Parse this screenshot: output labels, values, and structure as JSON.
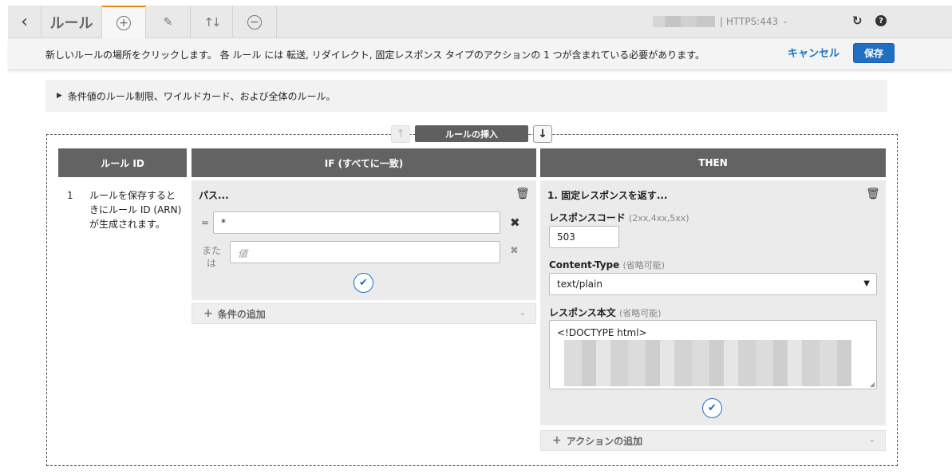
{
  "toolbar": {
    "back_icon": "chevron-left-icon",
    "title": "ルール",
    "add_icon": "plus-circle-icon",
    "edit_icon": "pencil-icon",
    "reorder_icon": "sort-arrows-icon",
    "remove_icon": "minus-circle-icon",
    "listener": "| HTTPS:443",
    "refresh_icon": "refresh-icon",
    "help_icon": "help-icon",
    "accent_color": "#e68a1a"
  },
  "infobar": {
    "message": "新しいルールの場所をクリックします。 各 ルール には 転送, リダイレクト, 固定レスポンス タイプのアクションの 1 つが含まれている必要があります。",
    "cancel_label": "キャンセル",
    "save_label": "保存",
    "primary_color": "#1f6fc5"
  },
  "limits": {
    "label": "条件値のルール制限、ワイルドカード、および全体のルール。"
  },
  "insert": {
    "label": "ルールの挿入"
  },
  "columns": {
    "rule_id": "ルール ID",
    "if": "IF (すべてに一致)",
    "then": "THEN"
  },
  "rule": {
    "number": "1",
    "id_note": "ルールを保存するときにルール ID (ARN) が生成されます。"
  },
  "condition": {
    "title": "パス...",
    "eq_label": "=",
    "value1": "*",
    "or_label": "または",
    "value2_placeholder": "値",
    "add_label": "条件の追加"
  },
  "action": {
    "title": "1. 固定レスポンスを返す...",
    "code_label": "レスポンスコード",
    "code_hint": "(2xx,4xx,5xx)",
    "code_value": "503",
    "ctype_label": "Content-Type",
    "ctype_hint": "(省略可能)",
    "ctype_value": "text/plain",
    "body_label": "レスポンス本文",
    "body_hint": "(省略可能)",
    "body_first_line": "<!DOCTYPE html>",
    "add_label": "アクションの追加"
  }
}
